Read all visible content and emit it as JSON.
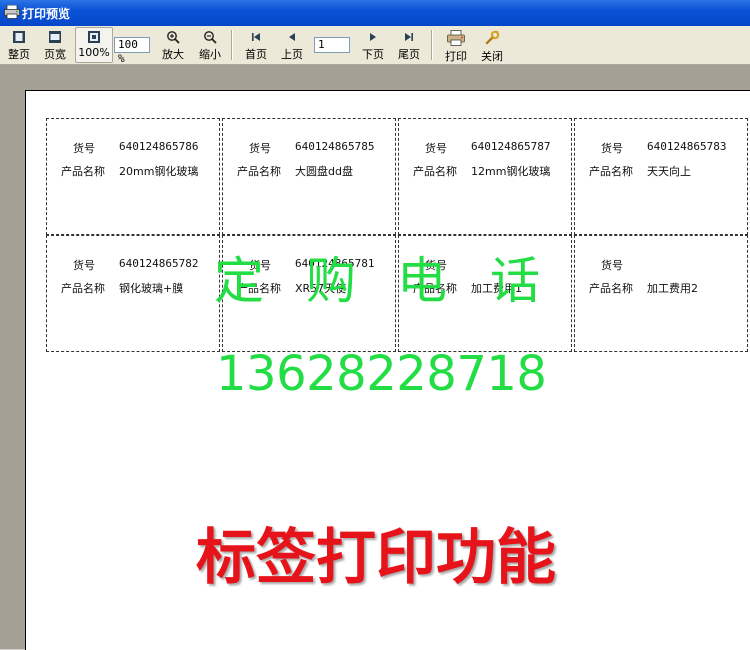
{
  "window": {
    "title": "打印预览"
  },
  "toolbar": {
    "whole_page": "整页",
    "page_width": "页宽",
    "zoom_100": "100%",
    "zoom_value": "100 %",
    "zoom_in": "放大",
    "zoom_out": "缩小",
    "first_page": "首页",
    "prev_page": "上页",
    "page_number": "1",
    "next_page": "下页",
    "last_page": "尾页",
    "print": "打印",
    "close": "关闭"
  },
  "field_labels": {
    "item_no": "货号",
    "product_name": "产品名称"
  },
  "labels": [
    {
      "item_no": "640124865786",
      "product_name": "20mm钢化玻璃"
    },
    {
      "item_no": "640124865785",
      "product_name": "大圆盘dd盘"
    },
    {
      "item_no": "640124865787",
      "product_name": "12mm钢化玻璃"
    },
    {
      "item_no": "640124865783",
      "product_name": "天天向上"
    },
    {
      "item_no": "640124865782",
      "product_name": "钢化玻璃+膜"
    },
    {
      "item_no": "640124865781",
      "product_name": "XR57天使"
    },
    {
      "item_no": "",
      "product_name": "加工费用1"
    },
    {
      "item_no": "",
      "product_name": "加工费用2"
    }
  ],
  "watermark": {
    "order_chars": [
      "定",
      "购",
      "电",
      "话"
    ],
    "phone": "13628228718",
    "feature": "标签打印功能"
  },
  "colors": {
    "watermark_green": "#22dd44",
    "watermark_red": "#e6141a",
    "titlebar": "#0a53d8"
  }
}
